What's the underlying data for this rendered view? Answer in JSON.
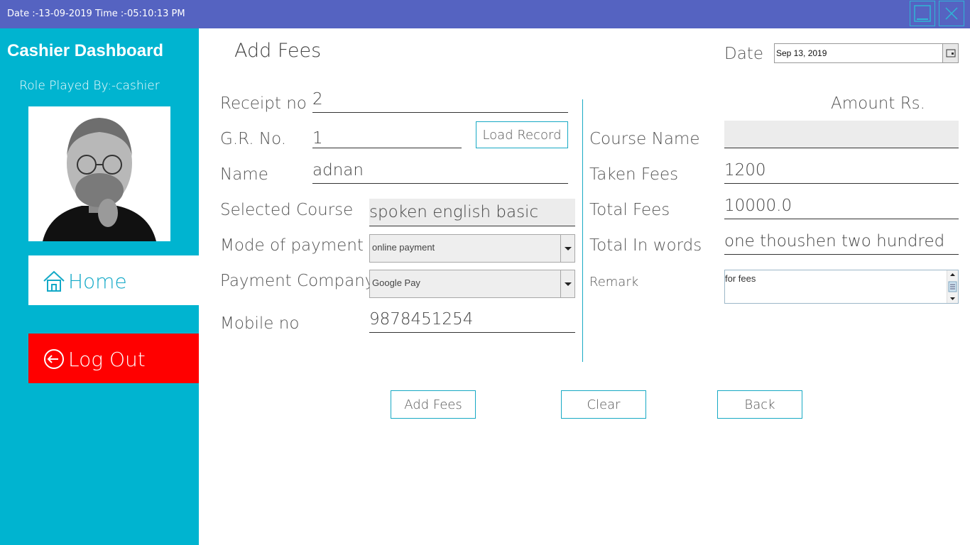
{
  "titlebar": {
    "datetime": "Date :-13-09-2019 Time :-05:10:13 PM",
    "minimize_icon": "minimize-icon",
    "close_icon": "close-icon"
  },
  "sidebar": {
    "title": "Cashier Dashboard",
    "role": "Role Played By:-cashier",
    "home_label": "Home",
    "home_icon": "home-icon",
    "logout_label": "Log Out",
    "logout_icon": "logout-icon"
  },
  "main": {
    "title": "Add Fees",
    "date_label": "Date",
    "date_value": "Sep 13, 2019",
    "amount_label": "Amount Rs.",
    "receipt_label": "Receipt no",
    "receipt_value": "2",
    "gr_label": "G.R. No.",
    "gr_value": "1",
    "load_record": "Load Record",
    "name_label": "Name",
    "name_value": "adnan",
    "selected_course_label": "Selected Course",
    "selected_course_value": "spoken english basic",
    "mode_label": "Mode of payment",
    "mode_value": "online payment",
    "company_label": "Payment Company",
    "company_value": "Google Pay",
    "mobile_label": "Mobile no",
    "mobile_value": "9878451254",
    "course_name_label": "Course Name",
    "course_name_value": "",
    "taken_fees_label": "Taken Fees",
    "taken_fees_value": "1200",
    "total_fees_label": "Total Fees",
    "total_fees_value": "10000.0",
    "words_label": "Total In words",
    "words_value": "one thoushen two hundred",
    "remark_label": "Remark",
    "remark_value": "for fees"
  },
  "actions": {
    "add": "Add Fees",
    "clear": "Clear",
    "back": "Back"
  },
  "colors": {
    "titlebar": "#5563c1",
    "sidebar": "#00b4d0",
    "logout": "#ff0000",
    "accent": "#17a9c4"
  }
}
